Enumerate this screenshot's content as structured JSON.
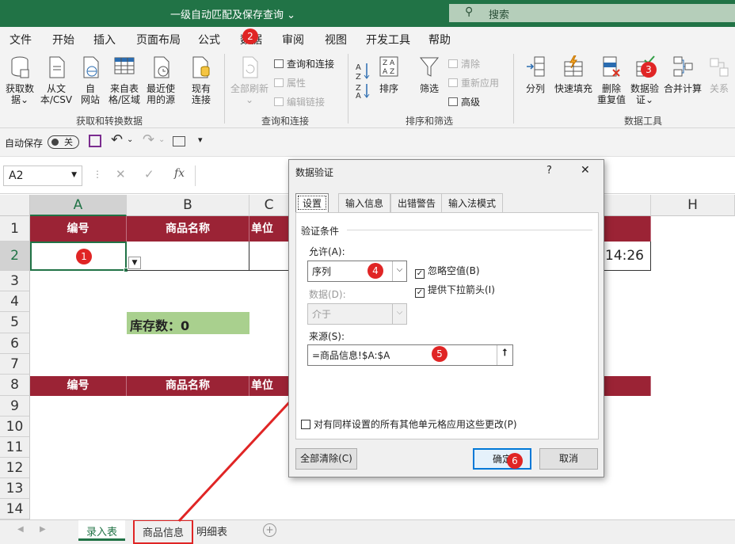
{
  "window": {
    "title": "一级自动匹配及保存查询 ⌄",
    "search_placeholder": "搜索"
  },
  "menu": [
    "文件",
    "开始",
    "插入",
    "页面布局",
    "公式",
    "数据",
    "审阅",
    "视图",
    "开发工具",
    "帮助"
  ],
  "ribbon": {
    "get_data": "获取数\n据⌄",
    "from_csv": "从文\n本/CSV",
    "from_web": "自\n网站",
    "from_table": "来自表\n格/区域",
    "recent": "最近使\n用的源",
    "existing": "现有\n连接",
    "refresh_all": "全部刷新",
    "queries_conn": "查询和连接",
    "properties": "属性",
    "edit_links": "编辑链接",
    "sort_az": "A→Z",
    "sort": "排序",
    "filter": "筛选",
    "clear": "清除",
    "reapply": "重新应用",
    "advanced": "高级",
    "split": "分列",
    "flash_fill": "快速填充",
    "remove_dup": "删除\n重复值",
    "validation": "数据验\n证⌄",
    "consolidate": "合并计算",
    "relations": "关系",
    "group_get": "获取和转换数据",
    "group_query": "查询和连接",
    "group_sort": "排序和筛选",
    "group_tools": "数据工具"
  },
  "qat": {
    "autosave": "自动保存",
    "toggle": "关"
  },
  "namebox": "A2",
  "fx": "fx",
  "columns": [
    "A",
    "B",
    "C",
    "H"
  ],
  "rows": [
    "1",
    "2",
    "3",
    "4",
    "5",
    "6",
    "7",
    "8",
    "9",
    "10",
    "11",
    "12",
    "13",
    "14"
  ],
  "headers_row1": [
    "编号",
    "商品名称",
    "单位"
  ],
  "headers_row8": [
    "编号",
    "商品名称",
    "单位"
  ],
  "stock_label": "库存数：0",
  "time_fragment": "14:26",
  "sheets": [
    "录入表",
    "商品信息",
    "明细表"
  ],
  "dialog": {
    "title": "数据验证",
    "help": "?",
    "close": "✕",
    "tabs": [
      "设置",
      "输入信息",
      "出错警告",
      "输入法模式"
    ],
    "section": "验证条件",
    "allow_label": "允许(A):",
    "allow_value": "序列",
    "ignore_blank": "忽略空值(B)",
    "dropdown_arrow": "提供下拉箭头(I)",
    "data_label": "数据(D):",
    "data_value": "介于",
    "source_label": "来源(S):",
    "source_value": "=商品信息!$A:$A",
    "apply_all": "对有同样设置的所有其他单元格应用这些更改(P)",
    "clear_all": "全部清除(C)",
    "ok": "确定",
    "cancel": "取消"
  },
  "badges": [
    "1",
    "2",
    "3",
    "4",
    "5",
    "6"
  ],
  "colors": {
    "excel_green": "#217346",
    "header_red": "#9b2335",
    "stock_green": "#a9d08e",
    "annotation_red": "#e02525"
  }
}
